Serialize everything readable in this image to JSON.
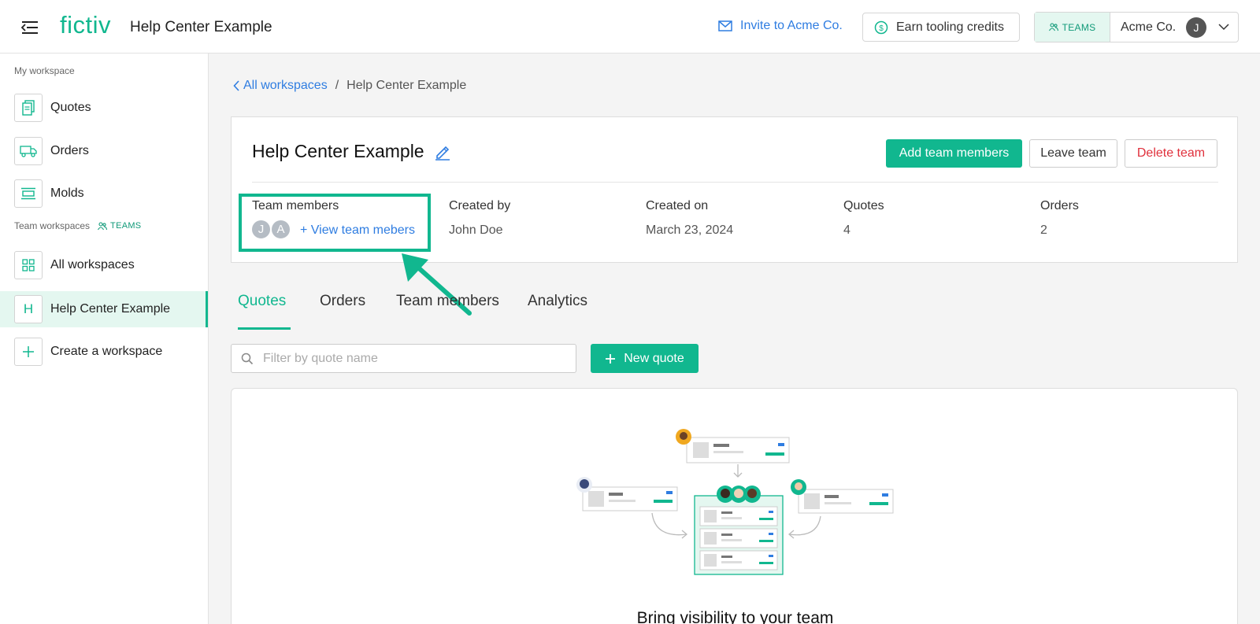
{
  "header": {
    "logo": "fictiv",
    "title": "Help Center Example",
    "invite_label": "Invite to Acme Co.",
    "earn_label": "Earn tooling credits",
    "teams_badge": "TEAMS",
    "account_name": "Acme Co.",
    "account_initial": "J"
  },
  "sidebar": {
    "my_workspace_label": "My workspace",
    "my_items": [
      {
        "label": "Quotes",
        "icon": "quotes-icon"
      },
      {
        "label": "Orders",
        "icon": "truck-icon"
      },
      {
        "label": "Molds",
        "icon": "molds-icon"
      }
    ],
    "team_workspaces_label": "Team workspaces",
    "teams_tag": "TEAMS",
    "team_items": [
      {
        "label": "All workspaces",
        "icon": "grid-icon"
      },
      {
        "label": "Help Center Example",
        "icon_letter": "H",
        "active": true
      },
      {
        "label": "Create a workspace",
        "icon": "plus-icon"
      }
    ]
  },
  "breadcrumb": {
    "back_label": "All workspaces",
    "separator": "/",
    "current": "Help Center Example"
  },
  "workspace": {
    "title": "Help Center Example",
    "add_members_label": "Add team members",
    "leave_label": "Leave team",
    "delete_label": "Delete team",
    "team_members_label": "Team members",
    "member_initials": [
      "J",
      "A"
    ],
    "view_members_link": "+ View team mebers",
    "created_by_label": "Created by",
    "created_by_value": "John Doe",
    "created_on_label": "Created on",
    "created_on_value": "March 23, 2024",
    "quotes_label": "Quotes",
    "quotes_value": "4",
    "orders_label": "Orders",
    "orders_value": "2"
  },
  "tabs": [
    {
      "label": "Quotes",
      "active": true
    },
    {
      "label": "Orders",
      "active": false
    },
    {
      "label": "Team members",
      "active": false
    },
    {
      "label": "Analytics",
      "active": false
    }
  ],
  "quotes": {
    "filter_placeholder": "Filter by quote name",
    "new_quote_label": "New quote",
    "empty_title": "Bring visibility to your team"
  },
  "colors": {
    "brand": "#11b78f",
    "link": "#2f7de1",
    "danger": "#e0303c"
  }
}
